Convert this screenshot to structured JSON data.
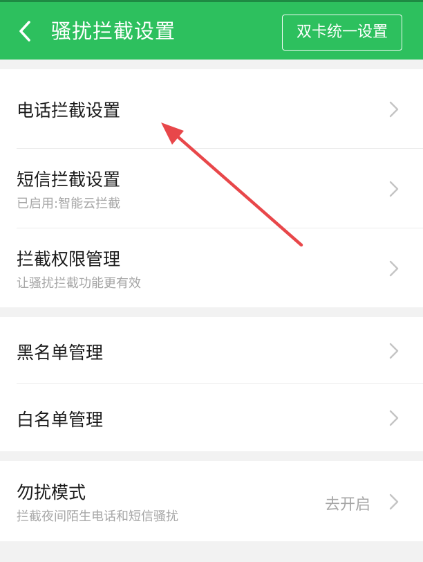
{
  "header": {
    "title": "骚扰拦截设置",
    "dual_sim_button": "双卡统一设置",
    "bg_color": "#2dc05e"
  },
  "section1": [
    {
      "label": "电话拦截设置",
      "sub": ""
    },
    {
      "label": "短信拦截设置",
      "sub": "已启用:智能云拦截"
    },
    {
      "label": "拦截权限管理",
      "sub": "让骚扰拦截功能更有效"
    }
  ],
  "section2": [
    {
      "label": "黑名单管理"
    },
    {
      "label": "白名单管理"
    }
  ],
  "section3": [
    {
      "label": "勿扰模式",
      "sub": "拦截夜间陌生电话和短信骚扰",
      "value": "去开启"
    }
  ],
  "icons": {
    "back": "chevron-left-icon",
    "row": "chevron-right-icon"
  },
  "annotation_color": "#e8474a"
}
